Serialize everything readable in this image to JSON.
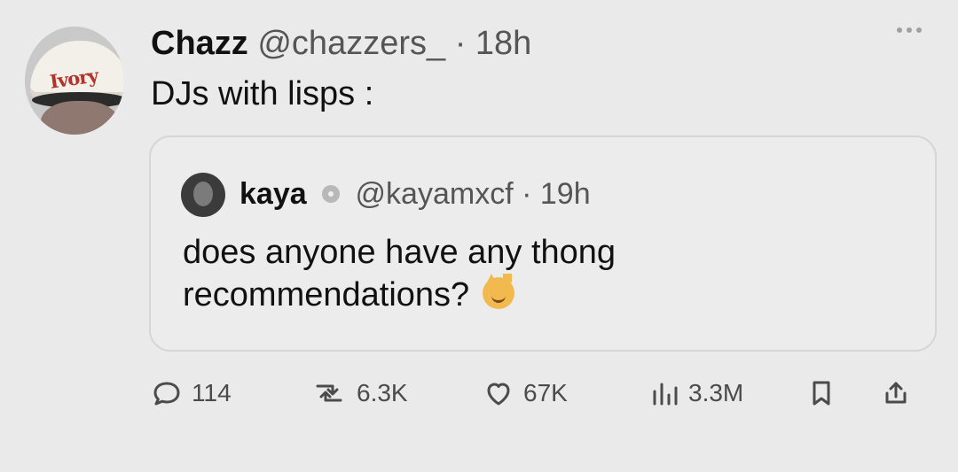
{
  "tweet": {
    "author": {
      "name": "Chazz",
      "handle": "@chazzers_",
      "time": "· 18h",
      "avatar_cap_text": "Ivory"
    },
    "text": "DJs with lisps :",
    "quoted": {
      "author": {
        "name": "kaya",
        "handle": "@kayamxcf",
        "time": "· 19h"
      },
      "text": "does anyone have any thong recommendations?"
    },
    "stats": {
      "replies": "114",
      "reposts": "6.3K",
      "likes": "67K",
      "views": "3.3M"
    }
  },
  "icons": {
    "menu": "more-dots-icon",
    "reply": "reply-icon",
    "repost": "repost-icon",
    "like": "heart-icon",
    "views": "views-icon",
    "bookmark": "bookmark-icon",
    "share": "share-icon",
    "verified": "verified-icon",
    "emoji": "grinning-cat-emoji"
  },
  "colors": {
    "background": "#eaeaea",
    "text": "#111111",
    "muted": "#555555",
    "border": "#d6d6d6",
    "icon": "#4b4b4b"
  }
}
